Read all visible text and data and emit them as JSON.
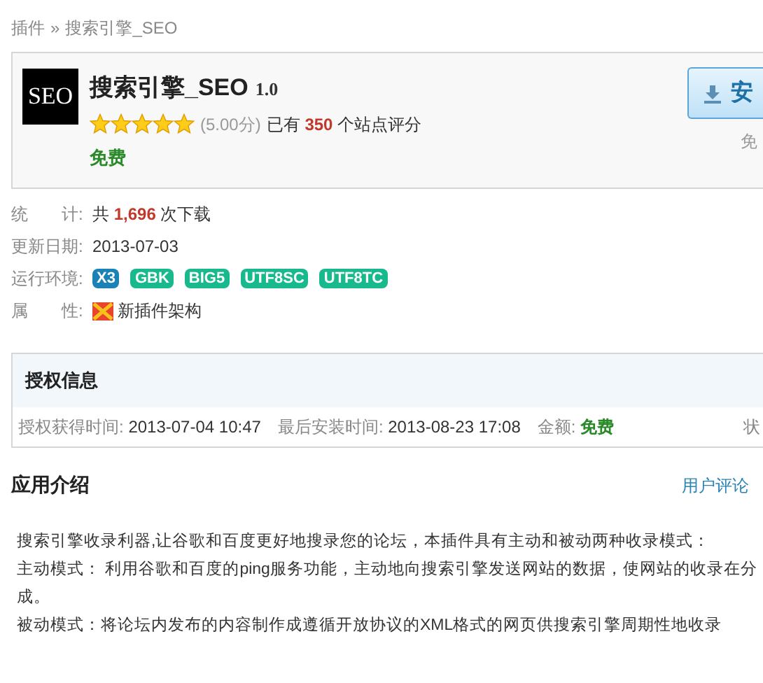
{
  "breadcrumb": {
    "root": "插件",
    "separator": "»",
    "current": "搜索引擎_SEO"
  },
  "plugin": {
    "logo_text": "SEO",
    "name": "搜索引擎_SEO",
    "version": "1.0",
    "stars": 5,
    "score": "(5.00分)",
    "rating_prefix": "已有",
    "rating_count": "350",
    "rating_suffix": "个站点评分",
    "price": "免费",
    "install_button": "安",
    "install_note": "免"
  },
  "stats": [
    {
      "kind": "count",
      "label": "统　　计:",
      "prefix": "共",
      "value": "1,696",
      "suffix": "次下载"
    },
    {
      "kind": "text",
      "label": "更新日期:",
      "value": "2013-07-03"
    },
    {
      "kind": "tags",
      "label": "运行环境:",
      "tags": [
        {
          "text": "X3",
          "color": "#1b82b8"
        },
        {
          "text": "GBK",
          "color": "#18b98c"
        },
        {
          "text": "BIG5",
          "color": "#18b98c"
        },
        {
          "text": "UTF8SC",
          "color": "#18b98c"
        },
        {
          "text": "UTF8TC",
          "color": "#18b98c"
        }
      ]
    },
    {
      "kind": "attribute",
      "label": "属　　性:",
      "value": "新插件架构"
    }
  ],
  "license": {
    "title": "授权信息",
    "fields": [
      {
        "label": "授权获得时间:",
        "value": "2013-07-04 10:47"
      },
      {
        "label": "最后安装时间:",
        "value": "2013-08-23 17:08"
      },
      {
        "label": "金额:",
        "value": "免费",
        "kind": "price"
      }
    ],
    "cut_label": "状"
  },
  "intro": {
    "title": "应用介绍",
    "link": "用户评论",
    "lines": [
      "搜索引擎收录利器,让谷歌和百度更好地搜录您的论坛，本插件具有主动和被动两种收录模式：",
      "主动模式： 利用谷歌和百度的ping服务功能，主动地向搜索引擎发送网站的数据，使网站的收录在分",
      "成。",
      "被动模式：将论坛内发布的内容制作成遵循开放协议的XML格式的网页供搜索引擎周期性地收录"
    ]
  }
}
